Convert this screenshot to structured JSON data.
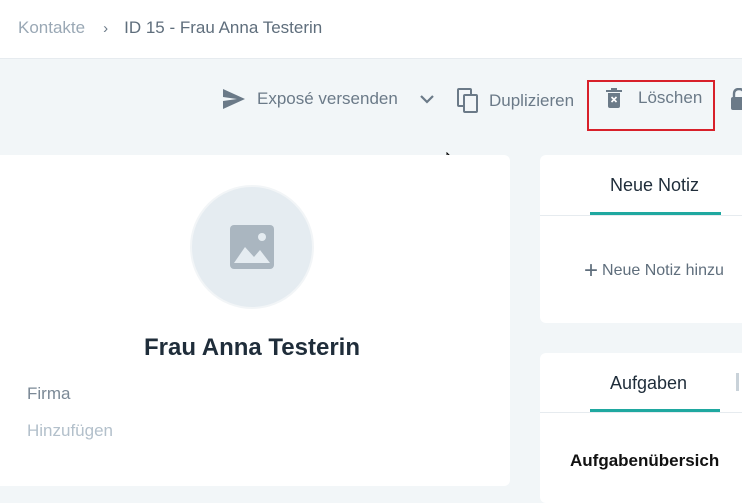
{
  "breadcrumb": {
    "root": "Kontakte",
    "separator": "›",
    "current": "ID 15 - Frau Anna Testerin"
  },
  "toolbar": {
    "send_label": "Exposé versenden",
    "duplicate_label": "Duplizieren",
    "delete_label": "Löschen"
  },
  "profile": {
    "name": "Frau Anna Testerin",
    "company_label": "Firma",
    "company_add": "Hinzufügen"
  },
  "notes_panel": {
    "tab_label": "Neue Notiz",
    "add_label": "Neue Notiz hinzu"
  },
  "tasks_panel": {
    "tab_label": "Aufgaben",
    "section_title": "Aufgabenübersich"
  },
  "colors": {
    "accent": "#1fa8a0",
    "highlight": "#d8202a",
    "background": "#f2f6f8"
  }
}
